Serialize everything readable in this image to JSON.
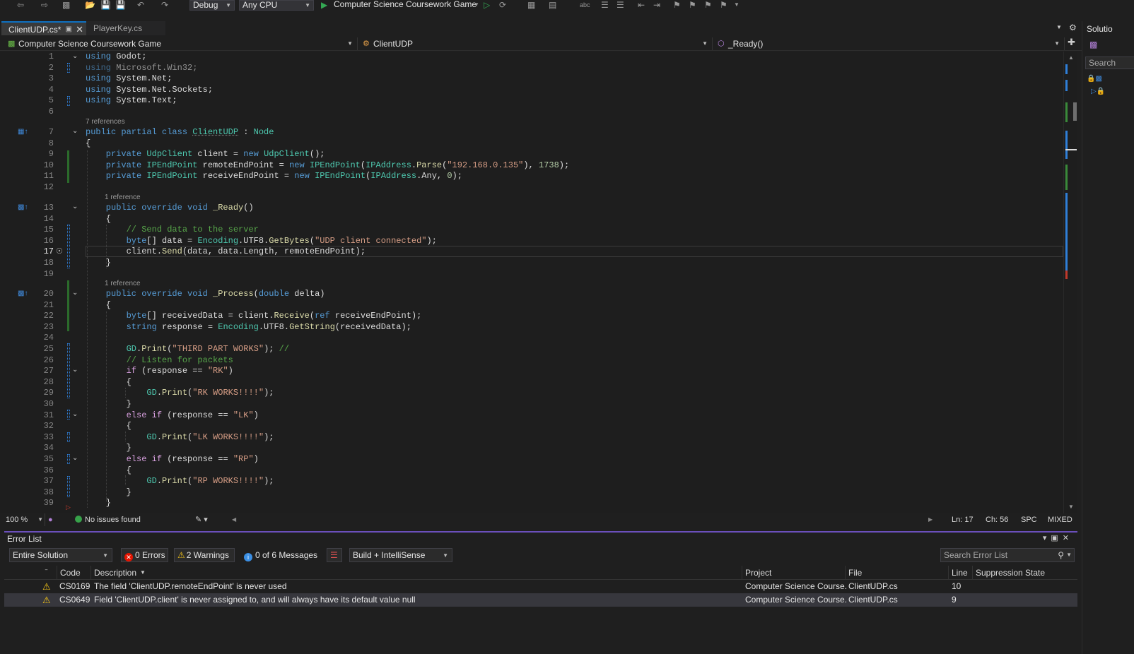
{
  "toolbar": {
    "configuration": "Debug",
    "platform": "Any CPU",
    "startup_project": "Computer Science Coursework Game"
  },
  "tabs": [
    {
      "label": "ClientUDP.cs*",
      "active": true
    },
    {
      "label": "PlayerKey.cs",
      "active": false
    }
  ],
  "nav": {
    "project": "Computer Science Coursework Game",
    "type": "ClientUDP",
    "member": "_Ready()"
  },
  "editor": {
    "current_line": 17,
    "code_lens": {
      "l7": "7 references",
      "l13": "1 reference",
      "l20": "1 reference"
    },
    "lines": {
      "l1": {
        "n": "1",
        "a": "using",
        "b": " Godot;"
      },
      "l2": {
        "n": "2",
        "a": "using",
        "b": " Microsoft.Win32;"
      },
      "l3": {
        "n": "3",
        "a": "using",
        "b": " System.Net;"
      },
      "l4": {
        "n": "4",
        "a": "using",
        "b": " System.Net.Sockets;"
      },
      "l5": {
        "n": "5",
        "a": "using",
        "b": " System.Text;"
      },
      "l6": {
        "n": "6"
      },
      "l7": {
        "n": "7",
        "a": "public partial class ",
        "b": "ClientUDP",
        "c": " : ",
        "d": "Node"
      },
      "l8": {
        "n": "8",
        "a": "{"
      },
      "l9": {
        "n": "9",
        "a": "    private ",
        "b": "UdpClient",
        "c": " client = ",
        "d": "new ",
        "e": "UdpClient",
        "f": "();"
      },
      "l10": {
        "n": "10",
        "a": "    private ",
        "b": "IPEndPoint",
        "c": " remoteEndPoint = ",
        "d": "new ",
        "e": "IPEndPoint",
        "f": "(",
        "g": "IPAddress",
        "h": ".",
        "i": "Parse",
        "j": "(",
        "k": "\"192.168.0.135\"",
        "l": "), ",
        "m": "1738",
        "o": ");"
      },
      "l11": {
        "n": "11",
        "a": "    private ",
        "b": "IPEndPoint",
        "c": " receiveEndPoint = ",
        "d": "new ",
        "e": "IPEndPoint",
        "f": "(",
        "g": "IPAddress",
        "h": ".Any, ",
        "i": "0",
        "j": ");"
      },
      "l12": {
        "n": "12"
      },
      "l13": {
        "n": "13",
        "a": "    public override void ",
        "b": "_Ready",
        "c": "()"
      },
      "l14": {
        "n": "14",
        "a": "    {"
      },
      "l15": {
        "n": "15",
        "a": "        // Send data to the server"
      },
      "l16": {
        "n": "16",
        "a": "        byte",
        "b": "[] data = ",
        "c": "Encoding",
        "d": ".UTF8.",
        "e": "GetBytes",
        "f": "(",
        "g": "\"UDP client connected\"",
        "h": ");"
      },
      "l17": {
        "n": "17",
        "a": "        client.",
        "b": "Send",
        "c": "(data, data.Length, remoteEndPoint);"
      },
      "l18": {
        "n": "18",
        "a": "    }"
      },
      "l19": {
        "n": "19"
      },
      "l20": {
        "n": "20",
        "a": "    public override void ",
        "b": "_Process",
        "c": "(",
        "d": "double",
        "e": " delta)"
      },
      "l21": {
        "n": "21",
        "a": "    {"
      },
      "l22": {
        "n": "22",
        "a": "        byte",
        "b": "[] receivedData = client.",
        "c": "Receive",
        "d": "(",
        "e": "ref",
        "f": " receiveEndPoint);"
      },
      "l23": {
        "n": "23",
        "a": "        string",
        "b": " response = ",
        "c": "Encoding",
        "d": ".UTF8.",
        "e": "GetString",
        "f": "(receivedData);"
      },
      "l24": {
        "n": "24"
      },
      "l25": {
        "n": "25",
        "a": "        GD",
        "b": ".",
        "c": "Print",
        "d": "(",
        "e": "\"THIRD PART WORKS\"",
        "f": "); ",
        "g": "//"
      },
      "l26": {
        "n": "26",
        "a": "        // Listen for packets"
      },
      "l27": {
        "n": "27",
        "a": "        if",
        "b": " (response == ",
        "c": "\"RK\"",
        "d": ")"
      },
      "l28": {
        "n": "28",
        "a": "        {"
      },
      "l29": {
        "n": "29",
        "a": "            GD",
        "b": ".",
        "c": "Print",
        "d": "(",
        "e": "\"RK WORKS!!!!\"",
        "f": ");"
      },
      "l30": {
        "n": "30",
        "a": "        }"
      },
      "l31": {
        "n": "31",
        "a": "        else if",
        "b": " (response == ",
        "c": "\"LK\"",
        "d": ")"
      },
      "l32": {
        "n": "32",
        "a": "        {"
      },
      "l33": {
        "n": "33",
        "a": "            GD",
        "b": ".",
        "c": "Print",
        "d": "(",
        "e": "\"LK WORKS!!!!\"",
        "f": ");"
      },
      "l34": {
        "n": "34",
        "a": "        }"
      },
      "l35": {
        "n": "35",
        "a": "        else if",
        "b": " (response == ",
        "c": "\"RP\"",
        "d": ")"
      },
      "l36": {
        "n": "36",
        "a": "        {"
      },
      "l37": {
        "n": "37",
        "a": "            GD",
        "b": ".",
        "c": "Print",
        "d": "(",
        "e": "\"RP WORKS!!!!\"",
        "f": ");"
      },
      "l38": {
        "n": "38",
        "a": "        }"
      },
      "l39": {
        "n": "39",
        "a": "    }"
      }
    }
  },
  "status": {
    "zoom": "100 %",
    "issues": "No issues found",
    "ln": "Ln: 17",
    "ch": "Ch: 56",
    "whitespace": "SPC",
    "line_endings": "MIXED"
  },
  "error_list": {
    "title": "Error List",
    "scope": "Entire Solution",
    "errors": "0 Errors",
    "warnings": "2 Warnings",
    "messages": "0 of 6 Messages",
    "source": "Build + IntelliSense",
    "search_placeholder": "Search Error List",
    "columns": {
      "code": "Code",
      "description": "Description",
      "project": "Project",
      "file": "File",
      "line": "Line",
      "suppression": "Suppression State"
    },
    "rows": [
      {
        "code": "CS0169",
        "description": "The field 'ClientUDP.remoteEndPoint' is never used",
        "project": "Computer Science Course...",
        "file": "ClientUDP.cs",
        "line": "10"
      },
      {
        "code": "CS0649",
        "description": "Field 'ClientUDP.client' is never assigned to, and will always have its default value null",
        "project": "Computer Science Course...",
        "file": "ClientUDP.cs",
        "line": "9"
      }
    ]
  },
  "side_panel": {
    "title": "Solutio",
    "search": "Search"
  }
}
